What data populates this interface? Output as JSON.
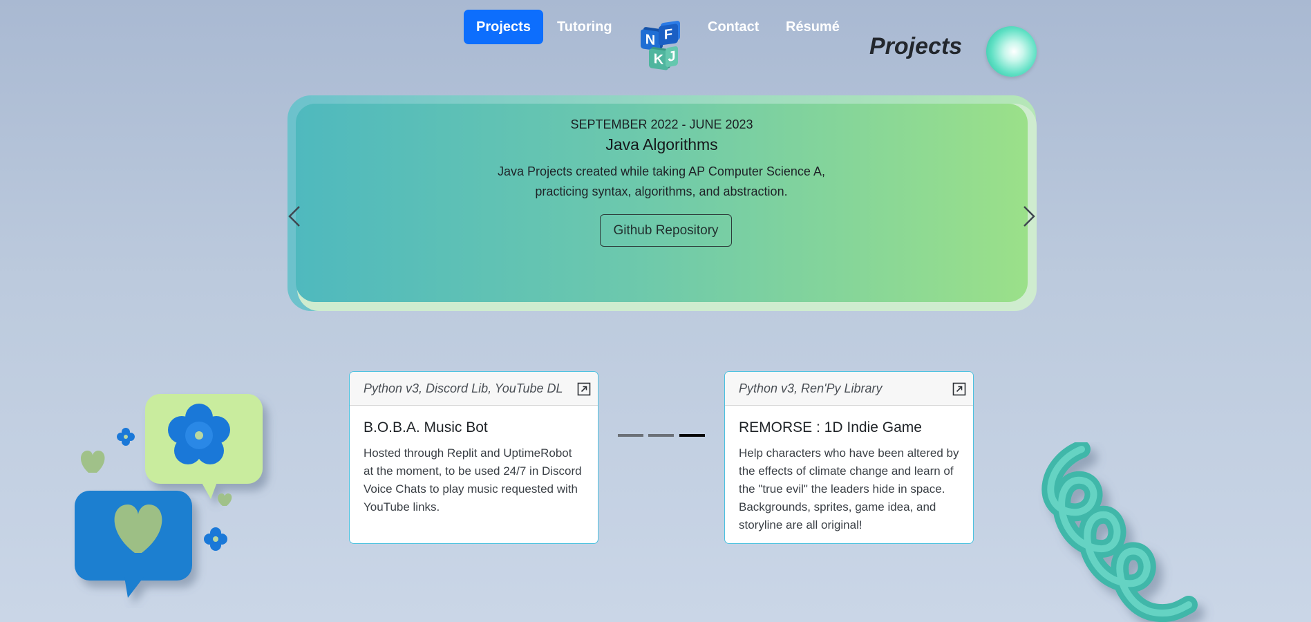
{
  "nav": {
    "projects": "Projects",
    "tutoring": "Tutoring",
    "contact": "Contact",
    "resume": "Résumé",
    "logo_letters": [
      "N",
      "F",
      "K",
      "J"
    ]
  },
  "page_heading": "Projects",
  "carousel": {
    "date": "SEPTEMBER 2022 - JUNE 2023",
    "title": "Java Algorithms",
    "description": "Java Projects created while taking AP Computer Science A, practicing syntax, algorithms, and abstraction.",
    "button_label": "Github Repository"
  },
  "cards": [
    {
      "tech": "Python v3, Discord Lib, YouTube DL",
      "title": "B.O.B.A. Music Bot",
      "description": "Hosted through Replit and UptimeRobot at the moment, to be used 24/7 in Discord Voice Chats to play music requested with YouTube links."
    },
    {
      "tech": "Python v3, Ren'Py Library",
      "title": "REMORSE : 1D Indie Game",
      "description": "Help characters who have been altered by the effects of climate change and learn of the \"true evil\" the leaders hide in space. Backgrounds, sprites, game idea, and storyline are all original!"
    }
  ],
  "indicators": {
    "count": 3,
    "active_index": 3
  },
  "colors": {
    "nav_active": "#0d6efd",
    "card_border": "#4cc1df",
    "slide_gradient_start": "#4fb9be",
    "slide_gradient_end": "#9be089"
  },
  "icons": {
    "external_link": "external-link-icon",
    "prev": "chevron-left-icon",
    "next": "chevron-right-icon"
  }
}
